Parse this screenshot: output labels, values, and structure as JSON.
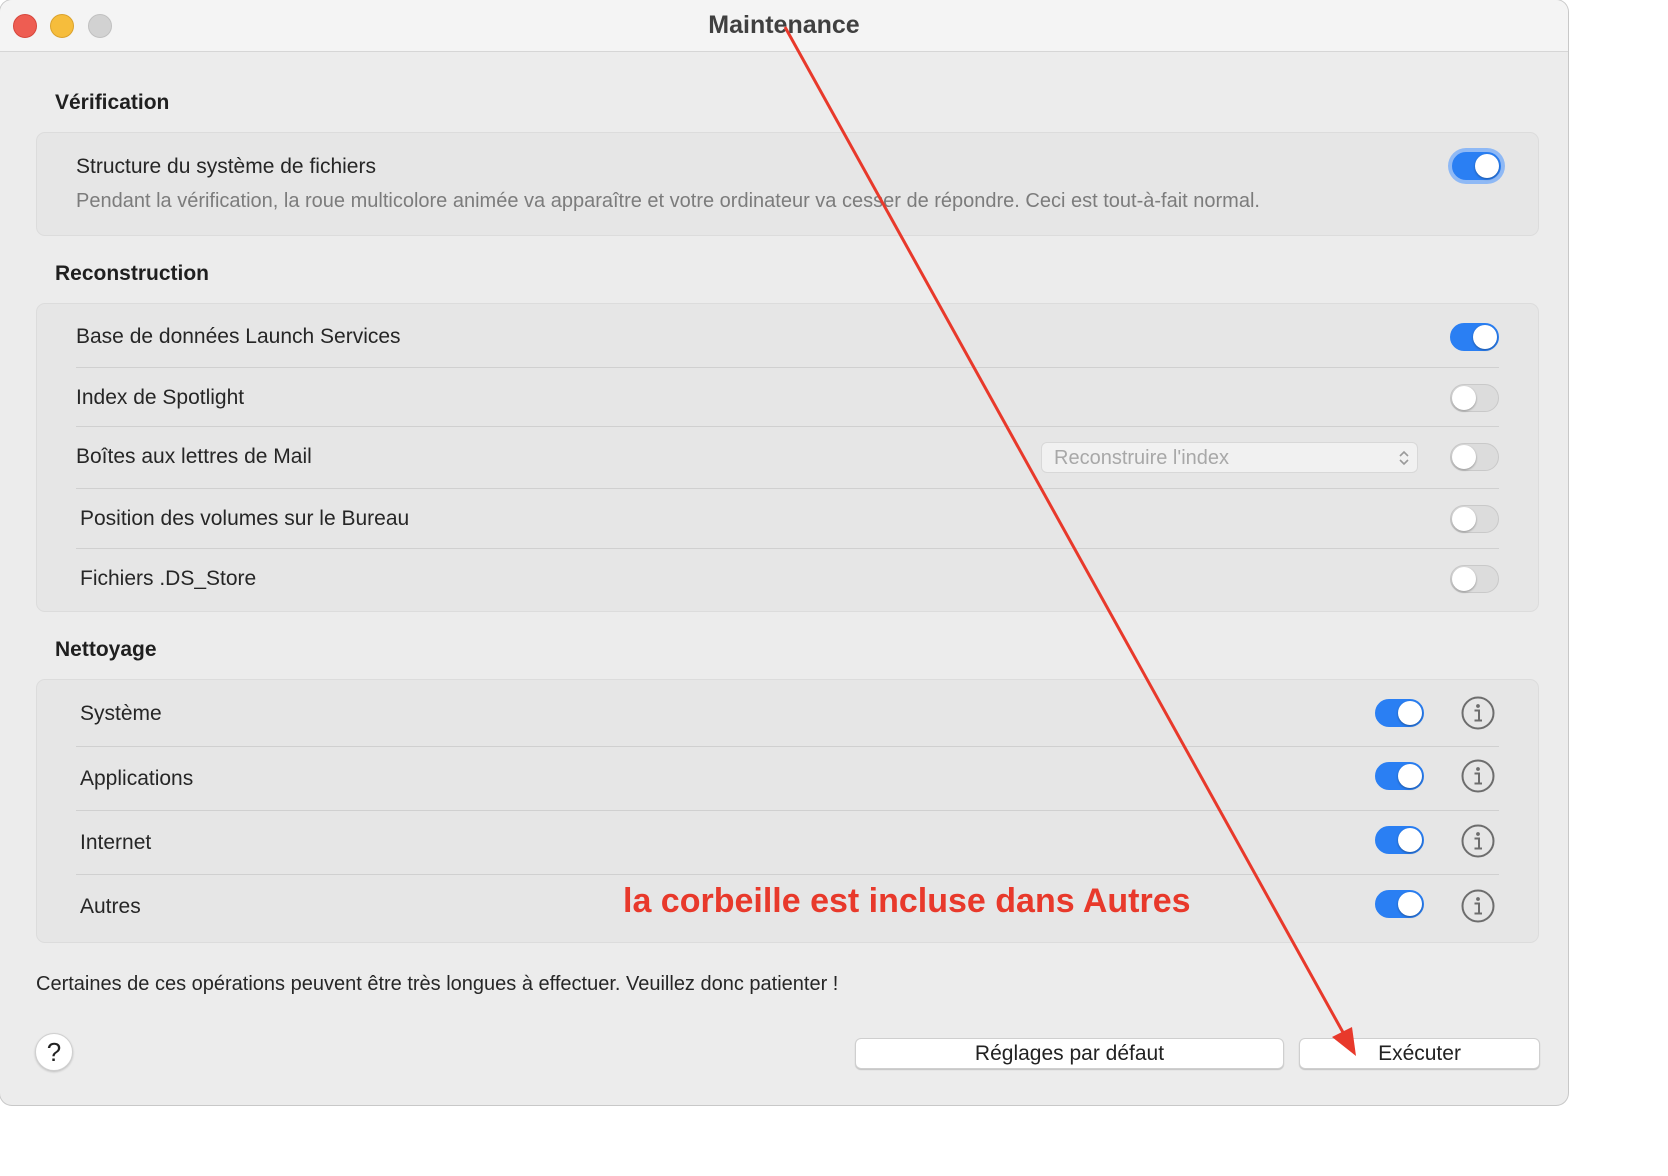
{
  "window": {
    "title": "Maintenance"
  },
  "verification": {
    "title": "Vérification",
    "items": [
      {
        "label": "Structure du système de fichiers",
        "description": "Pendant la vérification, la roue multicolore animée va apparaître et votre ordinateur va cesser de répondre. Ceci est tout-à-fait normal.",
        "enabled": true
      }
    ]
  },
  "reconstruction": {
    "title": "Reconstruction",
    "items": [
      {
        "label": "Base de données Launch Services",
        "enabled": true
      },
      {
        "label": "Index de Spotlight",
        "enabled": false
      },
      {
        "label": "Boîtes aux lettres de Mail",
        "enabled": false,
        "select_value": "Reconstruire l'index"
      },
      {
        "label": "Position des volumes sur le Bureau",
        "enabled": false
      },
      {
        "label": "Fichiers .DS_Store",
        "enabled": false
      }
    ]
  },
  "nettoyage": {
    "title": "Nettoyage",
    "items": [
      {
        "label": "Système",
        "enabled": true
      },
      {
        "label": "Applications",
        "enabled": true
      },
      {
        "label": "Internet",
        "enabled": true
      },
      {
        "label": "Autres",
        "enabled": true
      }
    ]
  },
  "footer": {
    "note": "Certaines de ces opérations peuvent être très longues à effectuer. Veuillez donc patienter !",
    "help_label": "?",
    "defaults_label": "Réglages par défaut",
    "run_label": "Exécuter"
  },
  "annotation": {
    "text": "la corbeille est incluse dans Autres",
    "color": "#e8392b"
  },
  "colors": {
    "accent": "#2a7ff3"
  }
}
